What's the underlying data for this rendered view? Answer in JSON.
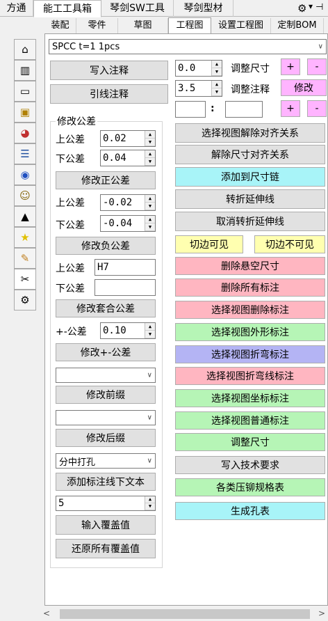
{
  "top_tabs": [
    {
      "label": "方通",
      "active": false
    },
    {
      "label": "能工工具箱",
      "active": true
    },
    {
      "label": "琴剑SW工具",
      "active": false
    },
    {
      "label": "琴剑型材",
      "active": false
    }
  ],
  "title_icons": {
    "settings": "gear-icon",
    "pin": "pin-icon"
  },
  "sub_tabs": [
    "装配",
    "零件",
    "草图",
    "工程图",
    "设置工程图",
    "定制BOM"
  ],
  "active_sub_tab": "工程图",
  "sidebar_icons": [
    "home-icon",
    "cube-icon",
    "folder-icon",
    "drawing-icon",
    "color-wheel-icon",
    "list-icon",
    "globe-icon",
    "user-icon",
    "graduation-cap-icon",
    "star-icon",
    "edit-icon",
    "tools-icon",
    "gear-icon"
  ],
  "material_select": "SPCC t=1 1pcs",
  "left": {
    "write_note": "写入注释",
    "leader_note": "引线注释",
    "tolerance_group": "修改公差",
    "upper_label": "上公差",
    "lower_label": "下公差",
    "pos_upper": "0.02",
    "pos_lower": "0.04",
    "modify_pos": "修改正公差",
    "neg_upper": "-0.02",
    "neg_lower": "-0.04",
    "modify_neg": "修改负公差",
    "fit_upper": "H7",
    "fit_lower": "",
    "modify_fit": "修改套合公差",
    "pm_label": "+-公差",
    "pm_value": "0.10",
    "modify_pm": "修改+-公差",
    "prefix_select": "",
    "modify_prefix": "修改前缀",
    "suffix_select": "",
    "modify_suffix": "修改后缀",
    "hole_select": "分中打孔",
    "add_text_below": "添加标注线下文本",
    "count_value": "5",
    "input_override": "输入覆盖值",
    "restore_override": "还原所有覆盖值"
  },
  "right": {
    "dim_value": "0.0",
    "adjust_dim": "调整尺寸",
    "note_value": "3.5",
    "adjust_note": "调整注释",
    "plus": "+",
    "minus": "-",
    "modify": "修改",
    "colon": ":",
    "field_a": "",
    "field_b": "",
    "buttons": [
      {
        "label": "选择视图解除对齐关系",
        "color": "#e1e1e1"
      },
      {
        "label": "解除尺寸对齐关系",
        "color": "#e1e1e1"
      },
      {
        "label": "添加到尺寸链",
        "color": "#a8f4f8"
      },
      {
        "label": "转折延伸线",
        "color": "#e1e1e1"
      },
      {
        "label": "取消转折延伸线",
        "color": "#e1e1e1"
      }
    ],
    "tangent_visible": "切边可见",
    "tangent_invisible": "切边不可见",
    "buttons2": [
      {
        "label": "删除悬空尺寸",
        "color": "#ffb6c1"
      },
      {
        "label": "删除所有标注",
        "color": "#ffb6c1"
      },
      {
        "label": "选择视图删除标注",
        "color": "#ffb6c1"
      },
      {
        "label": "选择视图外形标注",
        "color": "#b6f5b6"
      },
      {
        "label": "选择视图折弯标注",
        "color": "#b4b4f4"
      },
      {
        "label": "选择视图折弯线标注",
        "color": "#ffb6c1"
      },
      {
        "label": "选择视图坐标标注",
        "color": "#b6f5b6"
      },
      {
        "label": "选择视图普通标注",
        "color": "#b6f5b6"
      },
      {
        "label": "调整尺寸",
        "color": "#b6f5b6"
      },
      {
        "label": "写入技术要求",
        "color": "#e1e1e1"
      },
      {
        "label": "各类压铆规格表",
        "color": "#b6f5b6"
      },
      {
        "label": "生成孔表",
        "color": "#a8f4f8"
      }
    ]
  }
}
